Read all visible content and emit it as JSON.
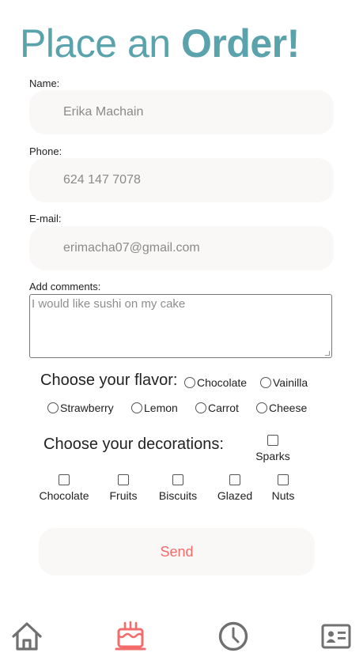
{
  "title": {
    "normal": "Place an ",
    "bold": "Order!"
  },
  "form": {
    "name": {
      "label": "Name:",
      "value": "Erika Machain"
    },
    "phone": {
      "label": "Phone:",
      "value": "624 147 7078"
    },
    "email": {
      "label": "E-mail:",
      "value": "erimacha07@gmail.com"
    },
    "comments": {
      "label": "Add comments:",
      "placeholder": "I would like sushi on my cake"
    }
  },
  "flavor": {
    "heading": "Choose your flavor:",
    "options": [
      "Chocolate",
      "Vainilla",
      "Strawberry",
      "Lemon",
      "Carrot",
      "Cheese"
    ]
  },
  "decorations": {
    "heading": "Choose your decorations:",
    "options": [
      "Sparks",
      "Chocolate",
      "Fruits",
      "Biscuits",
      "Glazed",
      "Nuts"
    ]
  },
  "send_label": "Send",
  "nav": {
    "icons": [
      "home-icon",
      "cake-icon",
      "clock-icon",
      "contact-card-icon"
    ],
    "active_color": "#f36c6c",
    "inactive_color": "#707070"
  },
  "colors": {
    "title": "#5aa3ad",
    "field_bg": "#faf7f7",
    "send_text": "#f36c6c"
  }
}
